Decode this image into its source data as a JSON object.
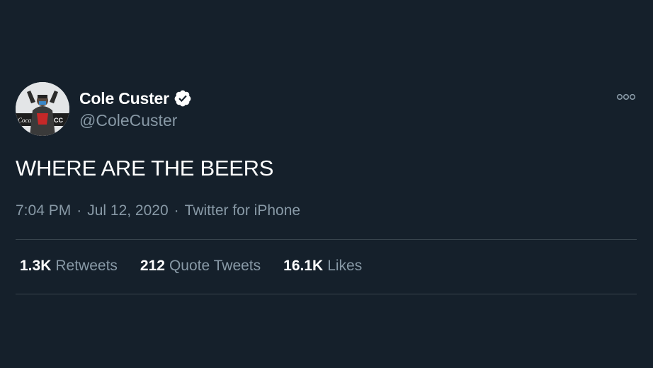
{
  "tweet": {
    "display_name": "Cole Custer",
    "handle": "@ColeCuster",
    "text": "WHERE ARE THE BEERS",
    "meta": {
      "time": "7:04 PM",
      "separator1": "·",
      "date": "Jul 12, 2020",
      "separator2": "·",
      "source": "Twitter for iPhone"
    },
    "stats": [
      {
        "value": "1.3K",
        "label": "Retweets"
      },
      {
        "value": "212",
        "label": "Quote Tweets"
      },
      {
        "value": "16.1K",
        "label": "Likes"
      }
    ],
    "icons": {
      "verified": "verified-badge-icon",
      "more": "more-options-icon"
    }
  },
  "colors": {
    "background": "#15202b",
    "primary_text": "#ffffff",
    "secondary_text": "#8899a6",
    "divider": "#38444d"
  }
}
